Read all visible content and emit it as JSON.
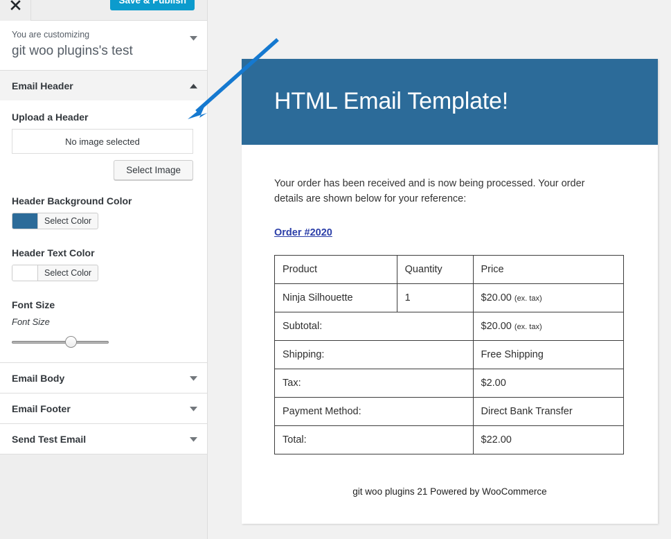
{
  "customizer": {
    "close_icon": "close-x-icon",
    "save_label": "Save & Publish",
    "info": {
      "eyebrow": "You are customizing",
      "site_title": "git woo plugins's test",
      "toggle_icon": "chevron-down-icon"
    },
    "sections": [
      {
        "title": "Email Header",
        "state": "expanded",
        "arrow_icon": "chevron-up-icon"
      },
      {
        "title": "Email Body",
        "state": "collapsed",
        "arrow_icon": "chevron-down-icon"
      },
      {
        "title": "Email Footer",
        "state": "collapsed",
        "arrow_icon": "chevron-down-icon"
      },
      {
        "title": "Send Test Email",
        "state": "collapsed",
        "arrow_icon": "chevron-down-icon"
      }
    ],
    "email_header_controls": {
      "upload": {
        "label": "Upload a Header",
        "placeholder_text": "No image selected",
        "button_label": "Select Image"
      },
      "header_background_color": {
        "label": "Header Background Color",
        "button_label": "Select Color",
        "value": "#2c6b99"
      },
      "header_text_color": {
        "label": "Header Text Color",
        "button_label": "Select Color",
        "value": "#ffffff"
      },
      "font_size": {
        "label": "Font Size",
        "sublabel": "Font Size",
        "slider_percent": 61
      }
    }
  },
  "preview": {
    "email": {
      "header_title": "HTML Email Template!",
      "header_bg": "#2c6b99",
      "header_text_color": "#ffffff",
      "intro_paragraph": "Your order has been received and is now being processed. Your order details are shown below for your reference:",
      "order_link": "Order #2020",
      "order_link_color": "#2b3ea8",
      "table": {
        "headers": [
          "Product",
          "Quantity",
          "Price"
        ],
        "rows": [
          {
            "type": "item",
            "product": "Ninja Silhouette",
            "quantity": "1",
            "price": "$20.00",
            "price_note": "(ex. tax)"
          },
          {
            "type": "summary",
            "label": "Subtotal:",
            "value": "$20.00",
            "value_note": "(ex. tax)"
          },
          {
            "type": "summary",
            "label": "Shipping:",
            "value": "Free Shipping",
            "value_note": ""
          },
          {
            "type": "summary",
            "label": "Tax:",
            "value": "$2.00",
            "value_note": ""
          },
          {
            "type": "summary",
            "label": "Payment Method:",
            "value": "Direct Bank Transfer",
            "value_note": ""
          },
          {
            "type": "summary",
            "label": "Total:",
            "value": "$22.00",
            "value_note": ""
          }
        ]
      },
      "footer_text": "git woo plugins 21 Powered by WooCommerce"
    }
  },
  "annotation": {
    "arrow_color": "#1579d0",
    "name": "pointer-arrow"
  }
}
